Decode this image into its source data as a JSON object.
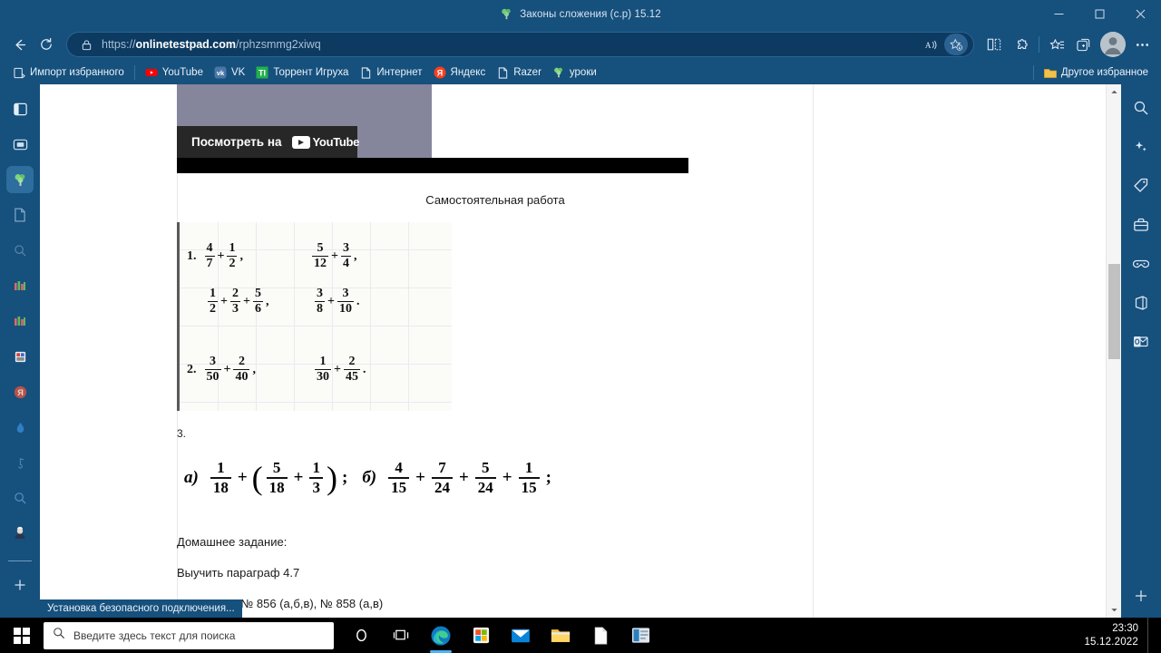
{
  "window": {
    "title": "Законы сложения (с.р) 15.12",
    "favicon": "broccoli-icon",
    "controls": {
      "minimize": "minimize-icon",
      "maximize": "maximize-icon",
      "close": "close-icon"
    }
  },
  "toolbar": {
    "back": "back-arrow-icon",
    "refresh": "refresh-icon",
    "lock": "lock-icon",
    "url_prefix": "https://",
    "url_domain": "onlinetestpad.com",
    "url_path": "/rphzsmmg2xiwq",
    "read_aloud": "read-aloud-icon",
    "add_favorite": "add-favorite-star-icon",
    "split_screen": "split-screen-icon",
    "extensions": "puzzle-piece-icon",
    "collections": "collections-icon",
    "browser_essentials": "browser-essentials-icon",
    "profile": "profile-avatar-icon",
    "settings_more": "more-ellipsis-icon"
  },
  "favorites": {
    "items": [
      {
        "label": "Импорт избранного",
        "icon": "import-favorites-icon"
      },
      {
        "label": "YouTube",
        "icon": "youtube-icon"
      },
      {
        "label": "VK",
        "icon": "vk-icon"
      },
      {
        "label": "Торрент Игруха",
        "icon": "torrent-igruha-icon"
      },
      {
        "label": "Интернет",
        "icon": "page-icon"
      },
      {
        "label": "Яндекс",
        "icon": "yandex-icon"
      },
      {
        "label": "Razer",
        "icon": "page-icon"
      },
      {
        "label": "уроки",
        "icon": "broccoli-icon"
      }
    ],
    "other": {
      "label": "Другое избранное",
      "icon": "folder-icon"
    }
  },
  "vertical_tabs": [
    {
      "name": "tab-list-icon",
      "selected": false
    },
    {
      "name": "browser-window-icon",
      "selected": false
    },
    {
      "name": "broccoli-tab-icon",
      "selected": true
    },
    {
      "name": "page-tab-icon",
      "selected": false
    },
    {
      "name": "search-tab-icon",
      "selected": false
    },
    {
      "name": "chart-tab-icon",
      "selected": false
    },
    {
      "name": "chart-tab-icon-2",
      "selected": false
    },
    {
      "name": "app-tab-icon",
      "selected": false
    },
    {
      "name": "yandex-tab-icon",
      "selected": false
    },
    {
      "name": "water-drop-tab-icon",
      "selected": false
    },
    {
      "name": "music-tab-icon",
      "selected": false
    },
    {
      "name": "magnifier-tab-icon",
      "selected": false
    },
    {
      "name": "avatar-tab-icon",
      "selected": false
    },
    {
      "name": "new-tab-plus-icon",
      "selected": false
    }
  ],
  "right_sidebar": [
    {
      "name": "search-sidebar-icon"
    },
    {
      "name": "copilot-sparkle-icon"
    },
    {
      "name": "shopping-tag-icon"
    },
    {
      "name": "tools-briefcase-icon"
    },
    {
      "name": "games-icon"
    },
    {
      "name": "office-icon"
    },
    {
      "name": "outlook-icon"
    },
    {
      "name": "add-sidebar-plus-icon"
    }
  ],
  "page": {
    "video": {
      "watch_label": "Посмотреть на",
      "brand": "YouTube"
    },
    "heading": "Самостоятельная работа",
    "tasks": [
      {
        "number": "1.",
        "rows": [
          {
            "left": [
              {
                "n": "4",
                "d": "7"
              },
              "+",
              {
                "n": "1",
                "d": "2"
              }
            ],
            "left_punct": ",",
            "right": [
              {
                "n": "5",
                "d": "12"
              },
              "+",
              {
                "n": "3",
                "d": "4"
              }
            ],
            "right_punct": ","
          },
          {
            "left": [
              {
                "n": "1",
                "d": "2"
              },
              "+",
              {
                "n": "2",
                "d": "3"
              },
              "+",
              {
                "n": "5",
                "d": "6"
              }
            ],
            "left_punct": ",",
            "right": [
              {
                "n": "3",
                "d": "8"
              },
              "+",
              {
                "n": "3",
                "d": "10"
              }
            ],
            "right_punct": "."
          }
        ]
      },
      {
        "number": "2.",
        "rows": [
          {
            "left": [
              {
                "n": "3",
                "d": "50"
              },
              "+",
              {
                "n": "2",
                "d": "40"
              }
            ],
            "left_punct": ",",
            "right": [
              {
                "n": "1",
                "d": "30"
              },
              "+",
              {
                "n": "2",
                "d": "45"
              }
            ],
            "right_punct": "."
          }
        ]
      }
    ],
    "task3_label": "3.",
    "task3": {
      "a_letter": "а)",
      "a_expr": [
        {
          "n": "1",
          "d": "18"
        },
        "+",
        "(",
        {
          "n": "5",
          "d": "18"
        },
        "+",
        {
          "n": "1",
          "d": "3"
        },
        ")",
        ";"
      ],
      "b_letter": "б)",
      "b_expr": [
        {
          "n": "4",
          "d": "15"
        },
        "+",
        {
          "n": "7",
          "d": "24"
        },
        "+",
        {
          "n": "5",
          "d": "24"
        },
        "+",
        {
          "n": "1",
          "d": "15"
        },
        ";"
      ]
    },
    "homework_title": "Домашнее задание:",
    "homework_line1": "Выучить параграф 4.7",
    "homework_line2": "Выполнить № 856 (а,б,в), № 858 (а,в)"
  },
  "status": {
    "text": "Установка безопасного подключения..."
  },
  "scrollbar": {
    "up": "scroll-up-arrow",
    "down": "scroll-down-arrow"
  },
  "taskbar": {
    "start": "windows-start-icon",
    "search_placeholder": "Введите здесь текст для поиска",
    "search_icon": "search-icon",
    "cortana": "cortana-circle-icon",
    "task_view": "task-view-icon",
    "apps": [
      {
        "name": "edge-icon",
        "running": true
      },
      {
        "name": "microsoft-store-icon",
        "running": false
      },
      {
        "name": "mail-icon",
        "running": false
      },
      {
        "name": "file-explorer-icon",
        "running": false
      },
      {
        "name": "notepad-icon",
        "running": false
      },
      {
        "name": "app-window-icon",
        "running": false
      }
    ],
    "clock_time": "23:30",
    "clock_date": "15.12.2022"
  },
  "colors": {
    "chrome_blue": "#16507d",
    "omnibox_blue": "#0c3a61",
    "accent": "#4cb4f5",
    "page_white": "#ffffff"
  }
}
